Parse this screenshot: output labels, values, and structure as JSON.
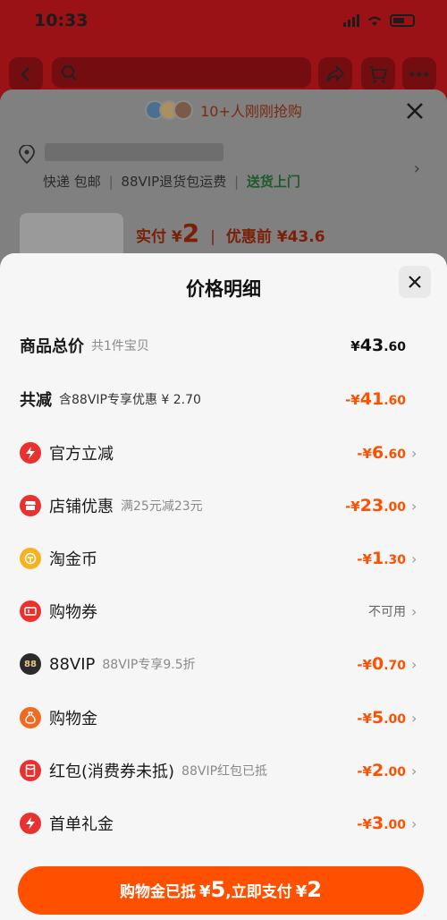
{
  "status": {
    "time": "10:33"
  },
  "background": {
    "promo_text": "10+人刚刚抢购",
    "shipping_express": "快递 包邮",
    "shipping_sep": "|",
    "shipping_return": "88VIP退货包运费",
    "shipping_pickup": "送货上门",
    "price_prefix": "实付",
    "price_currency": "¥",
    "price_value": "2",
    "price_sep": "|",
    "price_before": "优惠前 ¥43.6"
  },
  "modal": {
    "title": "价格明细",
    "total": {
      "label": "商品总价",
      "sub": "共1件宝贝",
      "currency": "¥",
      "int": "43",
      "dec": ".60"
    },
    "reduce": {
      "label": "共减",
      "sub": "含88VIP专享优惠 ¥ 2.70",
      "currency": "-¥",
      "int": "41",
      "dec": ".60"
    },
    "items": [
      {
        "label": "官方立减",
        "sub": "",
        "currency": "-¥",
        "int": "6",
        "dec": ".60",
        "icon": "lightning-icon",
        "color": "#e8322f"
      },
      {
        "label": "店铺优惠",
        "sub": "满25元减23元",
        "currency": "-¥",
        "int": "23",
        "dec": ".00",
        "icon": "shop-icon",
        "color": "#e8322f"
      },
      {
        "label": "淘金币",
        "sub": "",
        "currency": "-¥",
        "int": "1",
        "dec": ".30",
        "icon": "coin-icon",
        "color": "#f5b321"
      },
      {
        "label": "购物券",
        "sub": "",
        "na": "不可用",
        "icon": "coupon-icon",
        "color": "#e8322f"
      },
      {
        "label": "88VIP",
        "sub": "88VIP专享9.5折",
        "currency": "-¥",
        "int": "0",
        "dec": ".70",
        "icon": "vip-88-icon",
        "color": "#2b2b2b",
        "badge": "88"
      },
      {
        "label": "购物金",
        "sub": "",
        "currency": "-¥",
        "int": "5",
        "dec": ".00",
        "icon": "money-bag-icon",
        "color": "#f26a21"
      },
      {
        "label": "红包(消费券未抵)",
        "sub": "88VIP红包已抵",
        "currency": "-¥",
        "int": "2",
        "dec": ".00",
        "icon": "red-packet-icon",
        "color": "#e8322f"
      },
      {
        "label": "首单礼金",
        "sub": "",
        "currency": "-¥",
        "int": "3",
        "dec": ".00",
        "icon": "lightning-icon",
        "color": "#e8322f"
      }
    ],
    "pay_button": {
      "text1": "购物金已抵",
      "cur1": "¥",
      "amt1": "5",
      "text2": ",立即支付",
      "cur2": "¥",
      "amt2": "2"
    }
  },
  "colors": {
    "accent": "#ff5000",
    "brand_red": "#9b1216"
  }
}
